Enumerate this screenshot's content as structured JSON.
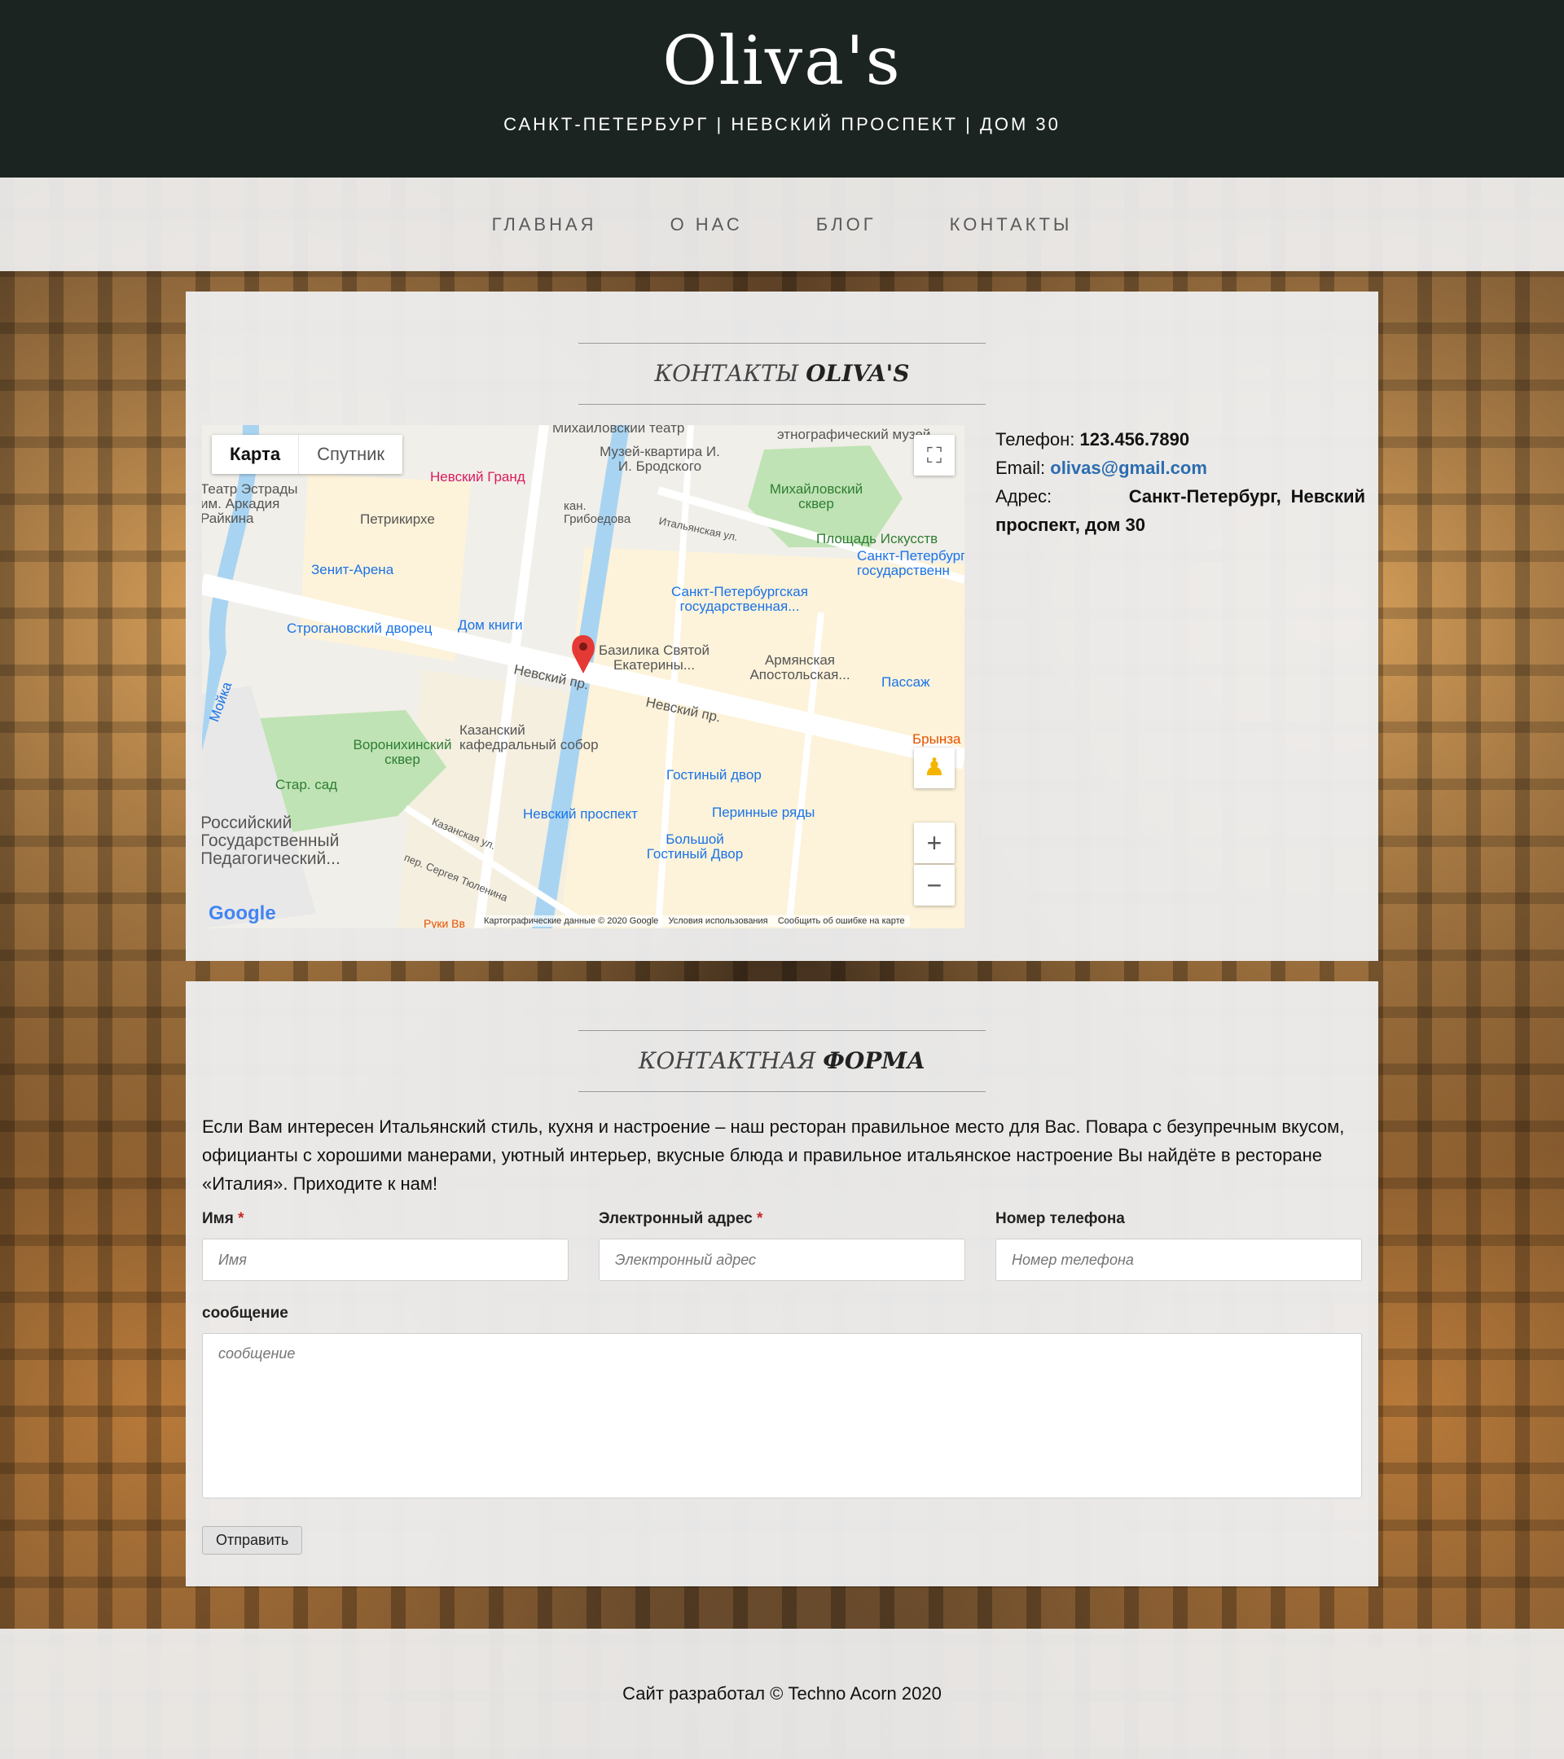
{
  "header": {
    "logo": "Oliva's",
    "tagline": "САНКТ-ПЕТЕРБУРГ | НЕВСКИЙ ПРОСПЕКТ | ДОМ 30"
  },
  "nav": {
    "items": [
      "ГЛАВНАЯ",
      "О НАС",
      "БЛОГ",
      "КОНТАКТЫ"
    ]
  },
  "contacts_section": {
    "title_light": "КОНТАКТЫ",
    "title_strong": "OLIVA'S",
    "phone_label": "Телефон:",
    "phone": "123.456.7890",
    "email_label": "Email:",
    "email": "olivas@gmail.com",
    "address_label": "Адрес:",
    "address": "Санкт-Петербург, Невский проспект, дом 30"
  },
  "map": {
    "tab_map": "Карта",
    "tab_satellite": "Спутник",
    "zoom_in": "+",
    "zoom_out": "−",
    "fullscreen": "⛶",
    "google": "Google",
    "attribution": "Картографические данные © 2020 Google",
    "terms": "Условия использования",
    "report": "Сообщить об ошибке на карте",
    "labels": {
      "mikhailovsky_theatre": "Михайловский театр",
      "ethnographic": "этнографический музей",
      "nevsky_grand": "Невский Гранд",
      "brodsky": "Музей-квартира И. И. Бродского",
      "estrada": "Театр Эстрады им. Аркадия Райкина",
      "petrikirche": "Петрикирхе",
      "griboedova": "кан. Грибоедова",
      "mikhailovsky_garden": "Михайловский сквер",
      "arts_square": "Площадь Искусств",
      "zenit": "Зенит-Арена",
      "spb_state": "Санкт-Петербургская государственная...",
      "spb_state2": "Санкт-Петербург государственн",
      "stroganov": "Строгановский дворец",
      "dom_knigi": "Дом книги",
      "catherine": "Базилика Святой Екатерины...",
      "armenian": "Армянская Апостольская...",
      "nevsky1": "Невский пр.",
      "nevsky2": "Невский пр.",
      "passage": "Пассаж",
      "moika": "Мойка",
      "bryinza": "Брынза",
      "kazan_cathedral": "Казанский кафедральный собор",
      "voronikhin": "Воронихинский сквер",
      "gostiny": "Гостиный двор",
      "stariy_sad": "Стар. сад",
      "nevsky_metro": "Невский проспект",
      "perinnye": "Перинные ряды",
      "pedagogical": "Российский Государственный Педагогический...",
      "bolshoy_gostiny": "Большой Гостиный Двор",
      "italyanskaya": "Итальянская ул.",
      "kazanskaya": "Казанская ул.",
      "tyulenina": "пер. Сергея Тюленина",
      "ruki_vverh": "Руки Вв"
    }
  },
  "form_section": {
    "title_light": "КОНТАКТНАЯ",
    "title_strong": "ФОРМА",
    "intro": "Если Вам интересен Итальянский стиль, кухня и настроение – наш ресторан правильное место для Вас. Повара с безупречным вкусом, официанты с хорошими манерами, уютный интерьер, вкусные блюда и правильное итальянское настроение Вы найдёте в ресторане «Италия». Приходите к нам!",
    "name_label": "Имя",
    "name_placeholder": "Имя",
    "email_label": "Электронный адрес",
    "email_placeholder": "Электронный адрес",
    "phone_label": "Номер телефона",
    "phone_placeholder": "Номер телефона",
    "message_label": "сообщение",
    "message_placeholder": "сообщение",
    "required_mark": "*",
    "submit": "Отправить"
  },
  "footer": {
    "text": "Сайт разработал © Techno Acorn 2020"
  }
}
